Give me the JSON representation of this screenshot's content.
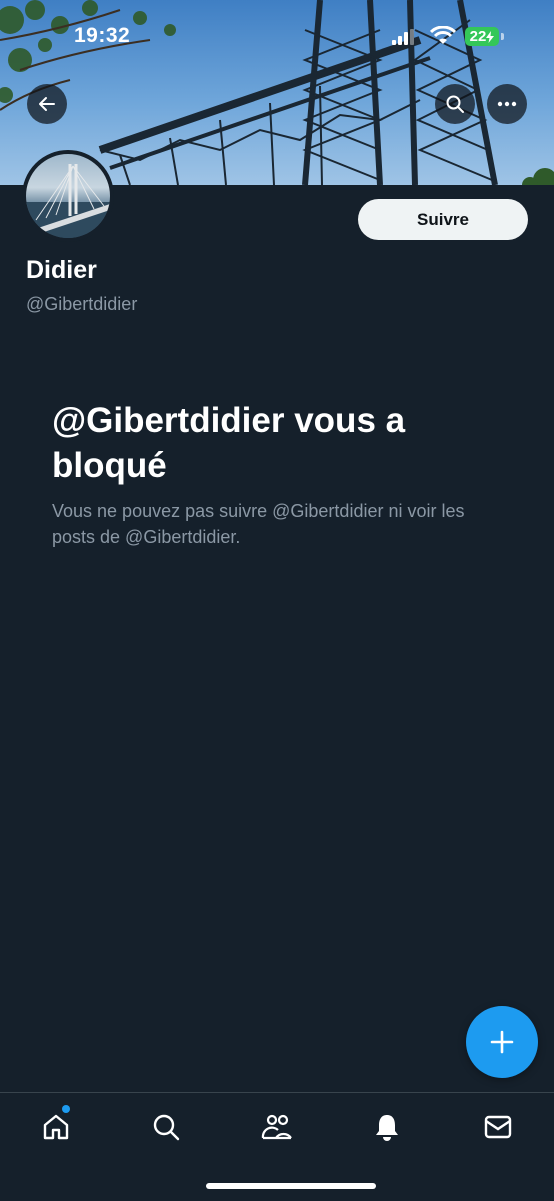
{
  "status_bar": {
    "time": "19:32",
    "battery": "22"
  },
  "profile": {
    "display_name": "Didier",
    "handle": "@Gibertdidier",
    "follow_label": "Suivre"
  },
  "blocked": {
    "title": "@Gibertdidier vous a bloqué",
    "description": "Vous ne pouvez pas suivre @Gibertdidier ni voir les posts de @Gibertdidier."
  },
  "icons": {
    "back": "arrow-left-icon",
    "search": "search-icon",
    "more": "more-icon",
    "compose": "plus-icon",
    "nav": [
      "home-icon",
      "search-icon",
      "communities-icon",
      "bell-icon",
      "mail-icon"
    ]
  },
  "colors": {
    "background": "#15202b",
    "accent": "#1d9bf0",
    "secondary_text": "#8b98a5",
    "follow_button": "#eff3f4"
  }
}
